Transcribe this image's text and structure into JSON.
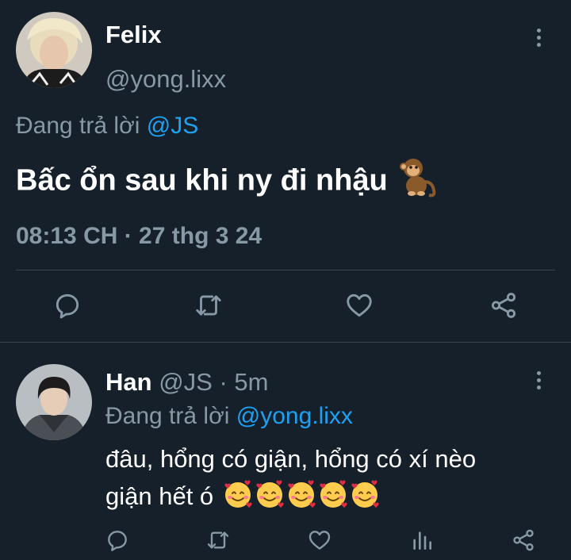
{
  "main_tweet": {
    "author_name": "Felix",
    "author_handle": "@yong.lixx",
    "reply_prefix": "Đang trả lời",
    "reply_to": "@JS",
    "text": "Bấc ổn sau khi ny đi nhậu",
    "text_emoji": "monkey",
    "timestamp": "08:13 CH · 27 thg 3 24",
    "actions": [
      "reply-icon",
      "retweet-icon",
      "like-icon",
      "share-icon"
    ]
  },
  "reply_tweet": {
    "author_name": "Han",
    "author_handle": "@JS",
    "time_ago": "· 5m",
    "reply_prefix": "Đang trả lời",
    "reply_to": "@yong.lixx",
    "text_line1": "đâu, hổng có giận, hổng có xí nèo",
    "text_line2": "giận hết ó",
    "emoji": "smiling-face-with-hearts",
    "emoji_count": 5,
    "actions": [
      "reply-icon",
      "retweet-icon",
      "like-icon",
      "analytics-icon",
      "share-icon"
    ]
  },
  "colors": {
    "background": "#15202b",
    "text": "#ffffff",
    "muted": "#8899a6",
    "accent": "#1da1f2",
    "divider": "#38444d"
  }
}
